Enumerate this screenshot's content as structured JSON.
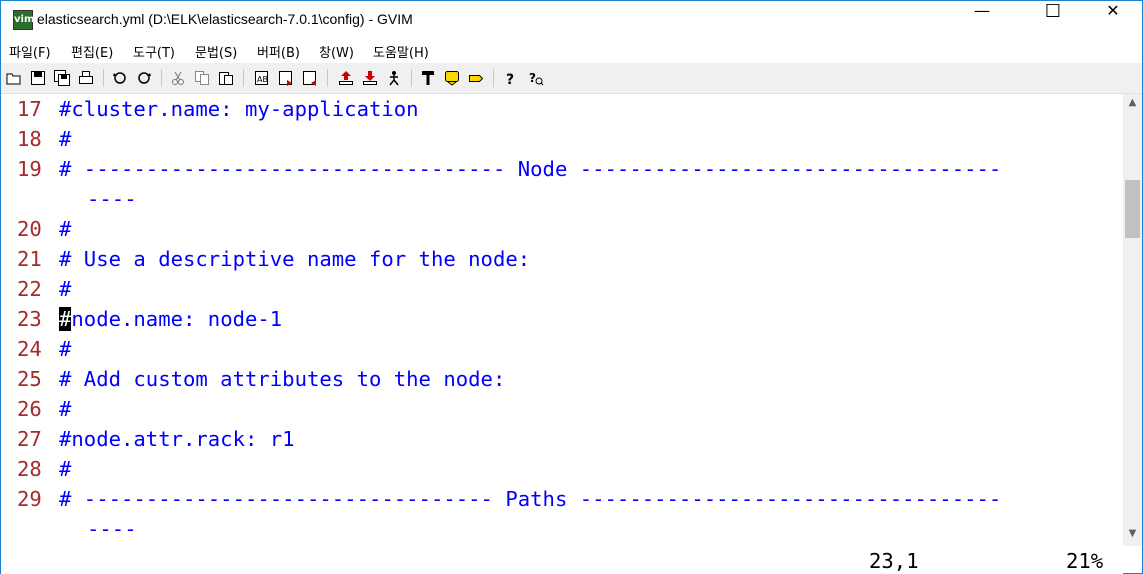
{
  "window": {
    "title": "elasticsearch.yml (D:\\ELK\\elasticsearch-7.0.1\\config) - GVIM",
    "icon_label": "vim",
    "minimize": "—",
    "maximize": "☐",
    "close": "✕"
  },
  "menu": [
    "파일(F)",
    "편집(E)",
    "도구(T)",
    "문법(S)",
    "버퍼(B)",
    "창(W)",
    "도움말(H)"
  ],
  "toolbar": {
    "icons": [
      "open-icon",
      "save-icon",
      "save-all-icon",
      "print-icon",
      "undo-icon",
      "redo-icon",
      "cut-icon",
      "copy-icon",
      "paste-icon",
      "find-replace-icon",
      "find-next-icon",
      "find-prev-icon",
      "load-session-icon",
      "save-session-icon",
      "run-script-icon",
      "make-icon",
      "shell-icon",
      "tag-jump-icon",
      "help-icon",
      "find-help-icon"
    ]
  },
  "editor": {
    "lines": [
      {
        "num": "17",
        "text": "#cluster.name: my-application"
      },
      {
        "num": "18",
        "text": "#"
      },
      {
        "num": "19",
        "text": "# ---------------------------------- Node ----------------------------------"
      },
      {
        "num": "",
        "text": "----"
      },
      {
        "num": "20",
        "text": "#"
      },
      {
        "num": "21",
        "text": "# Use a descriptive name for the node:"
      },
      {
        "num": "22",
        "text": "#"
      },
      {
        "num": "23",
        "cursor_char": "#",
        "text": "node.name: node-1"
      },
      {
        "num": "24",
        "text": "#"
      },
      {
        "num": "25",
        "text": "# Add custom attributes to the node:"
      },
      {
        "num": "26",
        "text": "#"
      },
      {
        "num": "27",
        "text": "#node.attr.rack: r1"
      },
      {
        "num": "28",
        "text": "#"
      },
      {
        "num": "29",
        "text": "# --------------------------------- Paths ----------------------------------"
      },
      {
        "num": "",
        "text": "----"
      }
    ],
    "colors": {
      "line_number": "#a52a2a",
      "comment": "#0000ff",
      "cursor_bg": "#000000"
    }
  },
  "status": {
    "position": "23,1",
    "percent": "21%"
  },
  "scrollbar": {
    "up": "▲",
    "down": "▼"
  }
}
